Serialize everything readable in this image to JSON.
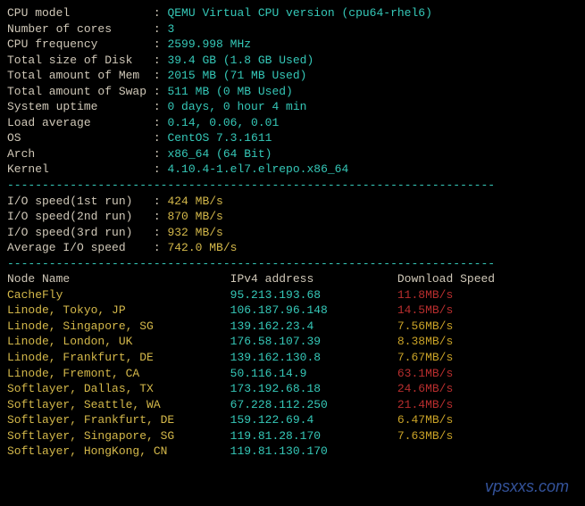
{
  "sysinfo": [
    {
      "label": "CPU model",
      "value": "QEMU Virtual CPU version (cpu64-rhel6)"
    },
    {
      "label": "Number of cores",
      "value": "3"
    },
    {
      "label": "CPU frequency",
      "value": "2599.998 MHz"
    },
    {
      "label": "Total size of Disk",
      "value": "39.4 GB (1.8 GB Used)"
    },
    {
      "label": "Total amount of Mem",
      "value": "2015 MB (71 MB Used)"
    },
    {
      "label": "Total amount of Swap",
      "value": "511 MB (0 MB Used)"
    },
    {
      "label": "System uptime",
      "value": "0 days, 0 hour 4 min"
    },
    {
      "label": "Load average",
      "value": "0.14, 0.06, 0.01"
    },
    {
      "label": "OS",
      "value": "CentOS 7.3.1611"
    },
    {
      "label": "Arch",
      "value": "x86_64 (64 Bit)"
    },
    {
      "label": "Kernel",
      "value": "4.10.4-1.el7.elrepo.x86_64"
    }
  ],
  "divider": "----------------------------------------------------------------------",
  "io": [
    {
      "label": "I/O speed(1st run)",
      "value": "424 MB/s"
    },
    {
      "label": "I/O speed(2nd run)",
      "value": "870 MB/s"
    },
    {
      "label": "I/O speed(3rd run)",
      "value": "932 MB/s"
    },
    {
      "label": "Average I/O speed",
      "value": "742.0 MB/s"
    }
  ],
  "header": {
    "node": "Node Name",
    "ip": "IPv4 address",
    "dl": "Download Speed"
  },
  "nodes": [
    {
      "name": "CacheFly",
      "ip": "95.213.193.68",
      "dl": "11.8MB/s",
      "c": "red"
    },
    {
      "name": "Linode, Tokyo, JP",
      "ip": "106.187.96.148",
      "dl": "14.5MB/s",
      "c": "red"
    },
    {
      "name": "Linode, Singapore, SG",
      "ip": "139.162.23.4",
      "dl": "7.56MB/s",
      "c": "ylw"
    },
    {
      "name": "Linode, London, UK",
      "ip": "176.58.107.39",
      "dl": "8.38MB/s",
      "c": "ylw"
    },
    {
      "name": "Linode, Frankfurt, DE",
      "ip": "139.162.130.8",
      "dl": "7.67MB/s",
      "c": "ylw"
    },
    {
      "name": "Linode, Fremont, CA",
      "ip": "50.116.14.9",
      "dl": "63.1MB/s",
      "c": "red"
    },
    {
      "name": "Softlayer, Dallas, TX",
      "ip": "173.192.68.18",
      "dl": "24.6MB/s",
      "c": "red"
    },
    {
      "name": "Softlayer, Seattle, WA",
      "ip": "67.228.112.250",
      "dl": "21.4MB/s",
      "c": "red"
    },
    {
      "name": "Softlayer, Frankfurt, DE",
      "ip": "159.122.69.4",
      "dl": "6.47MB/s",
      "c": "ylw"
    },
    {
      "name": "Softlayer, Singapore, SG",
      "ip": "119.81.28.170",
      "dl": "7.63MB/s",
      "c": "ylw"
    },
    {
      "name": "Softlayer, HongKong, CN",
      "ip": "119.81.130.170",
      "dl": "",
      "c": "ylw"
    }
  ],
  "watermark": "vpsxxs.com"
}
